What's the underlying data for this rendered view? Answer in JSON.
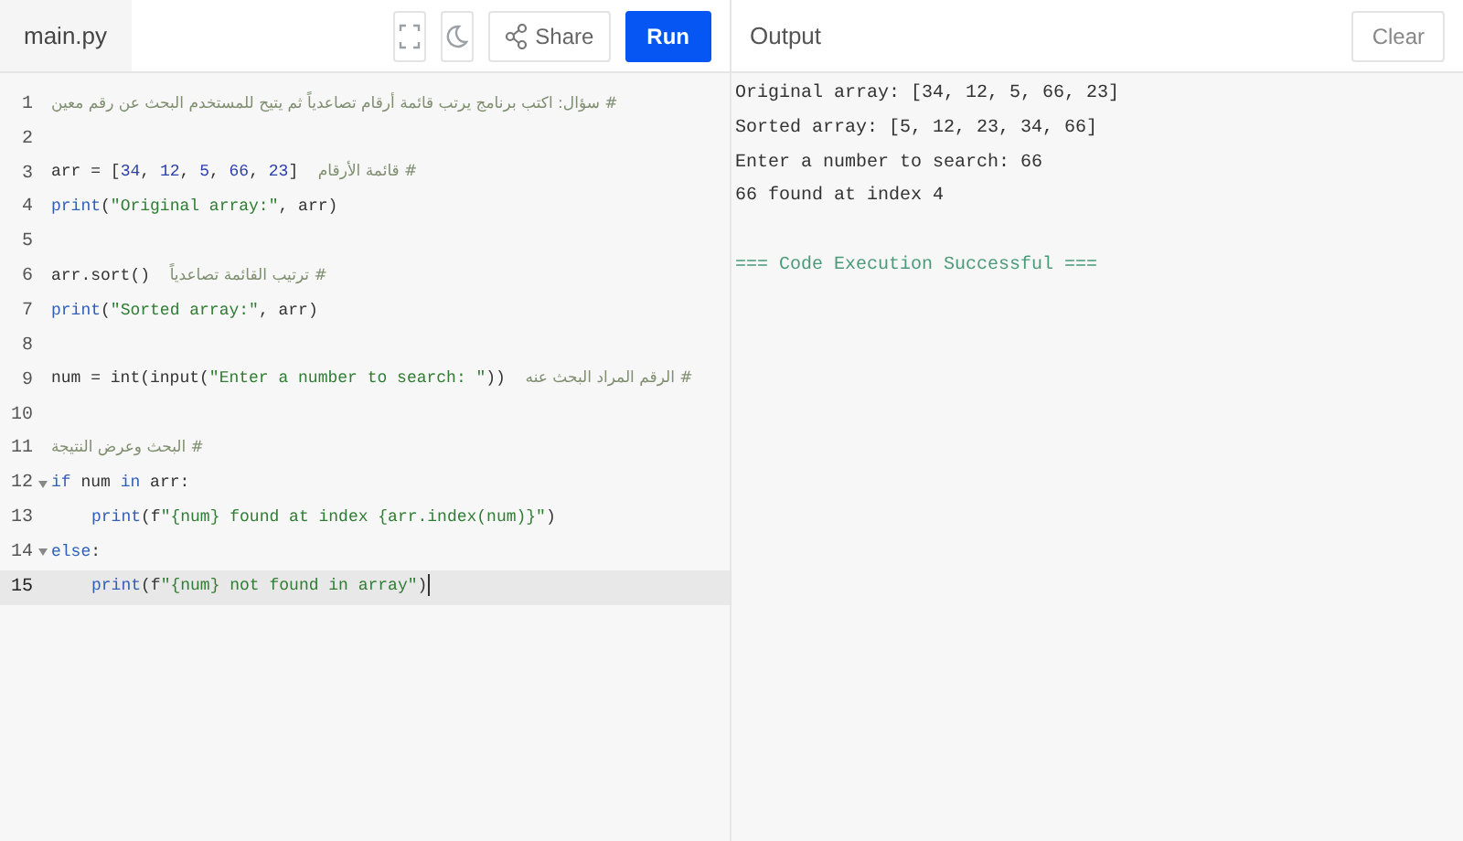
{
  "editor": {
    "file_tab": {
      "label": "main.py",
      "selected": true
    },
    "toolbar": [
      {
        "kind": "fullscreen"
      },
      {
        "kind": "theme"
      },
      {
        "kind": "share",
        "label": "Share"
      },
      {
        "kind": "run",
        "label": "Run"
      }
    ],
    "lines": [
      {
        "number": "1",
        "foldable": false,
        "active": false,
        "tokens": [
          {
            "kind": "comment",
            "text": "# سؤال: اكتب برنامج يرتب قائمة أرقام تصاعدياً ثم يتيح للمستخدم البحث عن رقم معين"
          }
        ]
      },
      {
        "number": "2",
        "foldable": false,
        "active": false
      },
      {
        "number": "3",
        "foldable": false,
        "active": false,
        "tokens": [
          {
            "kind": "plain",
            "text": "arr = ["
          },
          {
            "kind": "number",
            "text": "34"
          },
          {
            "kind": "plain",
            "text": ", "
          },
          {
            "kind": "number",
            "text": "12"
          },
          {
            "kind": "plain",
            "text": ", "
          },
          {
            "kind": "number",
            "text": "5"
          },
          {
            "kind": "plain",
            "text": ", "
          },
          {
            "kind": "number",
            "text": "66"
          },
          {
            "kind": "plain",
            "text": ", "
          },
          {
            "kind": "number",
            "text": "23"
          },
          {
            "kind": "plain",
            "text": "]  "
          },
          {
            "kind": "comment",
            "text": "# قائمة الأرقام"
          }
        ]
      },
      {
        "number": "4",
        "foldable": false,
        "active": false,
        "tokens": [
          {
            "kind": "builtin",
            "text": "print"
          },
          {
            "kind": "plain",
            "text": "("
          },
          {
            "kind": "string",
            "text": "\"Original array:\""
          },
          {
            "kind": "plain",
            "text": ", arr)"
          }
        ]
      },
      {
        "number": "5",
        "foldable": false,
        "active": false
      },
      {
        "number": "6",
        "foldable": false,
        "active": false,
        "tokens": [
          {
            "kind": "plain",
            "text": "arr.sort()  "
          },
          {
            "kind": "comment",
            "text": "# ترتيب القائمة تصاعدياً"
          }
        ]
      },
      {
        "number": "7",
        "foldable": false,
        "active": false,
        "tokens": [
          {
            "kind": "builtin",
            "text": "print"
          },
          {
            "kind": "plain",
            "text": "("
          },
          {
            "kind": "string",
            "text": "\"Sorted array:\""
          },
          {
            "kind": "plain",
            "text": ", arr)"
          }
        ]
      },
      {
        "number": "8",
        "foldable": false,
        "active": false
      },
      {
        "number": "9",
        "foldable": false,
        "active": false,
        "tokens": [
          {
            "kind": "plain",
            "text": "num = int(input("
          },
          {
            "kind": "string",
            "text": "\"Enter a number to search: \""
          },
          {
            "kind": "plain",
            "text": "))  "
          },
          {
            "kind": "comment",
            "text": "# الرقم المراد البحث عنه"
          }
        ]
      },
      {
        "number": "10",
        "foldable": false,
        "active": false
      },
      {
        "number": "11",
        "foldable": false,
        "active": false,
        "tokens": [
          {
            "kind": "comment",
            "text": "# البحث وعرض النتيجة"
          }
        ]
      },
      {
        "number": "12",
        "foldable": true,
        "active": false,
        "tokens": [
          {
            "kind": "keyword",
            "text": "if"
          },
          {
            "kind": "plain",
            "text": " num "
          },
          {
            "kind": "keyword",
            "text": "in"
          },
          {
            "kind": "plain",
            "text": " arr:"
          }
        ]
      },
      {
        "number": "13",
        "foldable": false,
        "active": false,
        "indented": true,
        "tokens": [
          {
            "kind": "builtin",
            "text": "print"
          },
          {
            "kind": "plain",
            "text": "(f"
          },
          {
            "kind": "string",
            "text": "\"{num} found at index {arr.index(num)}\""
          },
          {
            "kind": "plain",
            "text": ")"
          }
        ]
      },
      {
        "number": "14",
        "foldable": true,
        "active": false,
        "tokens": [
          {
            "kind": "keyword",
            "text": "else"
          },
          {
            "kind": "plain",
            "text": ":"
          }
        ]
      },
      {
        "number": "15",
        "foldable": false,
        "active": true,
        "indented": true,
        "tokens": [
          {
            "kind": "builtin",
            "text": "print"
          },
          {
            "kind": "plain",
            "text": "(f"
          },
          {
            "kind": "string",
            "text": "\"{num} not found in array\""
          },
          {
            "kind": "plain",
            "text": ")"
          }
        ]
      }
    ]
  },
  "output": {
    "title": "Output",
    "clear_button": "Clear",
    "lines": [
      {
        "kind": "stdout",
        "text": "Original array: [34, 12, 5, 66, 23]"
      },
      {
        "kind": "stdout",
        "text": "Sorted array: [5, 12, 23, 34, 66]"
      },
      {
        "kind": "stdout",
        "text": "Enter a number to search: 66"
      },
      {
        "kind": "stdout",
        "text": "66 found at index 4"
      },
      {
        "kind": "blank"
      },
      {
        "kind": "status",
        "text": "=== Code Execution Successful ==="
      }
    ]
  }
}
